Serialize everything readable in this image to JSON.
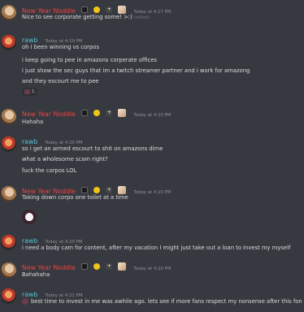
{
  "messages": [
    {
      "author": "New Year Noddle",
      "timestamp": "Today at 4:17 PM",
      "lines": [
        "Nice to see corporate getting some! >:)"
      ],
      "edited": "(edited)"
    },
    {
      "author": "rawb",
      "timestamp": "Today at 4:19 PM",
      "lines": [
        "oh i been winning vs corpos",
        "i keep going to pee in amazons corperate offices",
        "i just show the sec guys that im a twitch streamer partner and i work for amazong",
        "and they escourt me to pee"
      ],
      "reaction": {
        "icon": "sticker-emoji-icon",
        "count": "1"
      }
    },
    {
      "author": "New Year Noddle",
      "timestamp": "Today at 4:20 PM",
      "lines": [
        "Hahaha"
      ]
    },
    {
      "author": "rawb",
      "timestamp": "Today at 4:20 PM",
      "lines": [
        "so i get an armed escourt to shit on amazons dime",
        "what a wholesome scam right?",
        "fuck the corpos LOL"
      ]
    },
    {
      "author": "New Year Noddle",
      "timestamp": "Today at 4:20 PM",
      "lines": [
        "Taking down corpo one toilet at a time"
      ]
    },
    {
      "author": "rawb",
      "timestamp": "Today at 4:20 PM",
      "lines": [
        "i need a body cam for content, after my vacation I might just take out a loan to invest my myself"
      ]
    },
    {
      "author": "New Year Noddle",
      "timestamp": "Today at 4:20 PM",
      "lines": [
        "Bahahaha"
      ]
    },
    {
      "author": "rawb",
      "timestamp": "Today at 4:21 PM",
      "lines": [
        "best time to invest in me was awhile ago. lets see if more fans respect my nonsense after this fon"
      ]
    }
  ],
  "colors": {
    "background": "#36393f",
    "noddle_name": "#ed4245",
    "rawb_name": "#5dc2d8",
    "timestamp": "#8e9297",
    "text": "#dcddde"
  }
}
